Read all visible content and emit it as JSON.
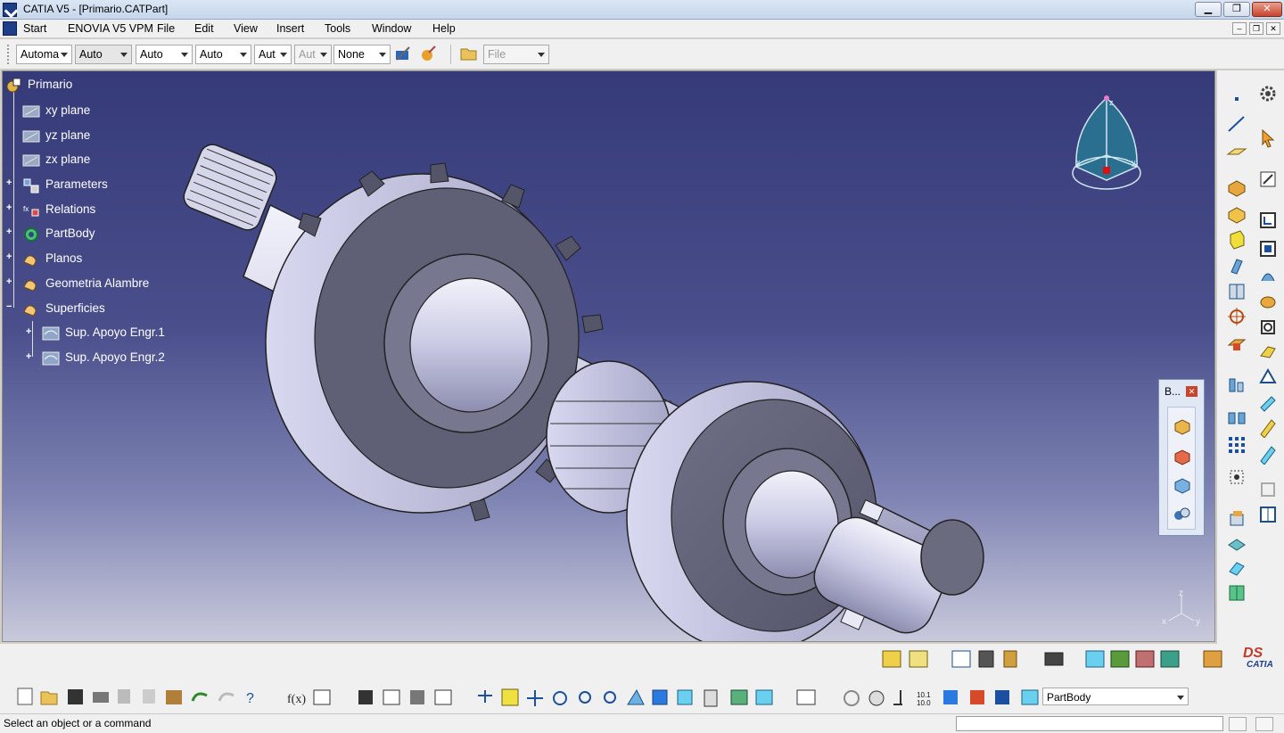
{
  "window": {
    "title": "CATIA V5 - [Primario.CATPart]",
    "minimize": "▁",
    "restore": "❐",
    "close": "✕"
  },
  "menu": {
    "items": [
      "Start",
      "ENOVIA V5 VPM",
      "File",
      "Edit",
      "View",
      "Insert",
      "Tools",
      "Window",
      "Help"
    ],
    "child_min": "–",
    "child_restore": "❐",
    "child_close": "✕"
  },
  "toolbar": {
    "combos": [
      "Automa",
      "Auto",
      "Auto",
      "Auto",
      "Aut",
      "Aut",
      "None"
    ],
    "file_combo": "File"
  },
  "tree": {
    "root": "Primario",
    "nodes": [
      "xy plane",
      "yz plane",
      "zx plane",
      "Parameters",
      "Relations",
      "PartBody",
      "Planos",
      "Geometria Alambre",
      "Superficies",
      "Sup. Apoyo Engr.1",
      "Sup. Apoyo Engr.2"
    ]
  },
  "compass": {
    "x": "x",
    "y": "y",
    "z": "z"
  },
  "axis": {
    "x": "x",
    "y": "y",
    "z": "z"
  },
  "panel": {
    "title": "B...",
    "close": "✕"
  },
  "bottom_toolbar": {
    "body_combo": "PartBody",
    "catia_label": "CATIA",
    "ds_label": "DS"
  },
  "status": {
    "message": "Select an object or a command"
  }
}
